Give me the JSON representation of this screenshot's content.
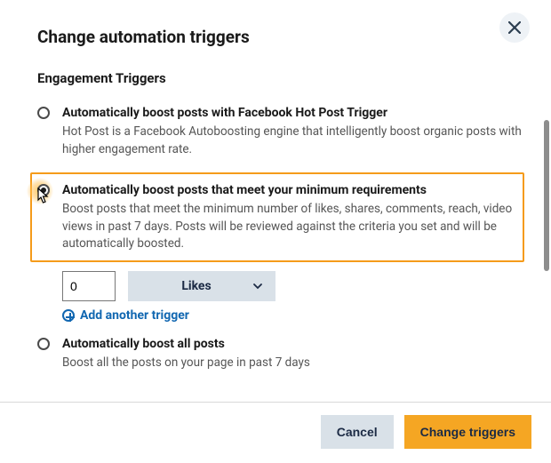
{
  "dialog": {
    "title": "Change automation triggers",
    "section_title": "Engagement Triggers"
  },
  "options": {
    "hotpost": {
      "title": "Automatically boost posts with Facebook Hot Post Trigger",
      "desc": "Hot Post is a Facebook Autoboosting engine that intelligently boost organic posts with higher engagement rate."
    },
    "minreq": {
      "title": "Automatically boost posts that meet your minimum requirements",
      "desc": "Boost posts that meet the minimum number of likes, shares, comments, reach, video views in past 7 days. Posts will be reviewed against the criteria you set and will be automatically boosted.",
      "input_value": "0",
      "metric": "Likes",
      "add_trigger_label": "Add another trigger"
    },
    "all": {
      "title": "Automatically boost all posts",
      "desc": "Boost all the posts on your page in past 7 days"
    }
  },
  "footer": {
    "cancel": "Cancel",
    "confirm": "Change triggers"
  }
}
